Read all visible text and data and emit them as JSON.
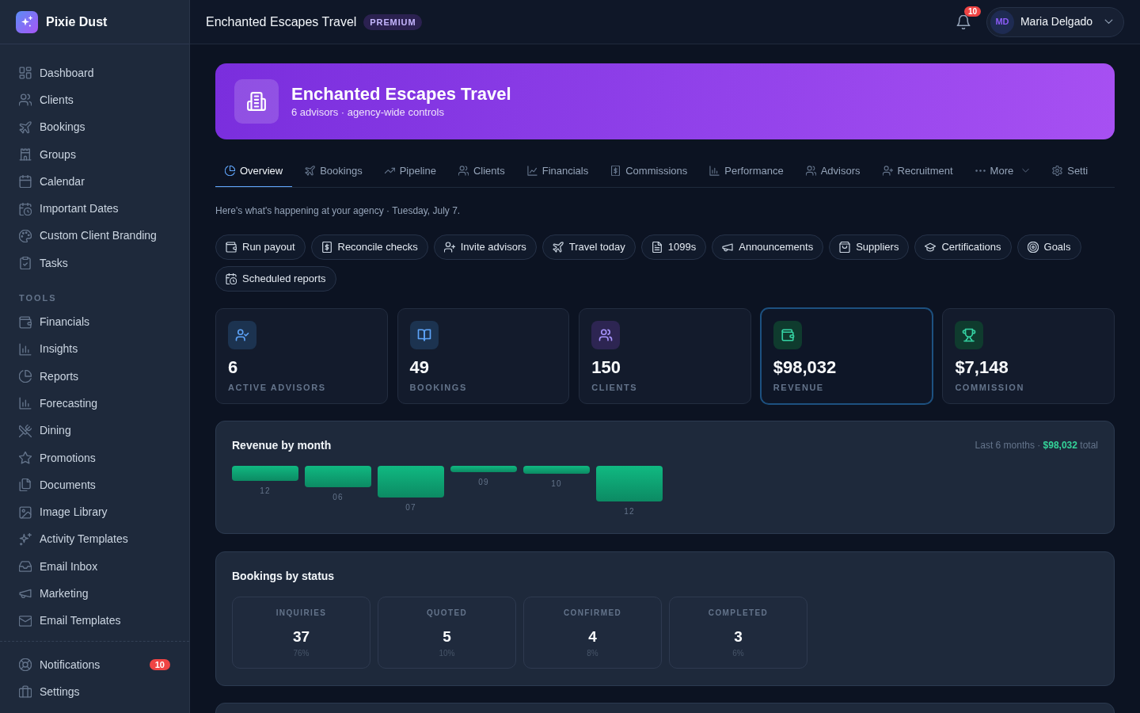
{
  "sidebar": {
    "brand": "Pixie Dust",
    "sections": [
      {
        "items": [
          {
            "label": "Dashboard"
          },
          {
            "label": "Clients"
          },
          {
            "label": "Bookings"
          },
          {
            "label": "Groups"
          },
          {
            "label": "Calendar"
          },
          {
            "label": "Important Dates"
          },
          {
            "label": "Custom Client Branding"
          },
          {
            "label": "Tasks"
          }
        ]
      },
      {
        "heading": "TOOLS",
        "items": [
          {
            "label": "Financials"
          },
          {
            "label": "Insights"
          },
          {
            "label": "Reports"
          },
          {
            "label": "Forecasting"
          },
          {
            "label": "Dining"
          },
          {
            "label": "Promotions"
          },
          {
            "label": "Documents"
          },
          {
            "label": "Image Library"
          },
          {
            "label": "Activity Templates"
          },
          {
            "label": "Email Inbox"
          },
          {
            "label": "Marketing"
          },
          {
            "label": "Email Templates"
          }
        ]
      }
    ],
    "footer_items": [
      {
        "label": "Notifications",
        "badge": "10"
      },
      {
        "label": "Settings"
      }
    ]
  },
  "header": {
    "title": "Enchanted Escapes Travel",
    "plan_badge": "PREMIUM",
    "notification_count": "10",
    "user": {
      "initials": "MD",
      "name": "Maria Delgado"
    }
  },
  "banner": {
    "title": "Enchanted Escapes Travel",
    "subtitle": "6 advisors · agency-wide controls"
  },
  "tabs": [
    {
      "label": "Overview",
      "kind": "link",
      "selected": true
    },
    {
      "label": "Bookings",
      "kind": "link",
      "selected": false
    },
    {
      "label": "Pipeline",
      "kind": "link",
      "selected": false
    },
    {
      "label": "Clients",
      "kind": "link",
      "selected": false
    },
    {
      "label": "Financials",
      "kind": "link",
      "selected": false
    },
    {
      "label": "Commissions",
      "kind": "link",
      "selected": false
    },
    {
      "label": "Performance",
      "kind": "link",
      "selected": false
    },
    {
      "label": "Advisors",
      "kind": "link",
      "selected": false
    },
    {
      "label": "Recruitment",
      "kind": "link",
      "selected": false
    },
    {
      "label": "More",
      "kind": "dropdown",
      "selected": false
    },
    {
      "label": "Setti",
      "kind": "link",
      "selected": false
    }
  ],
  "greeting": "Here's what's happening at your agency · Tuesday, July 7.",
  "quick_actions": [
    "Run payout",
    "Reconcile checks",
    "Invite advisors",
    "Travel today",
    "1099s",
    "Announcements",
    "Suppliers",
    "Certifications",
    "Goals",
    "Scheduled reports"
  ],
  "stats": [
    {
      "value": "6",
      "label": "ACTIVE ADVISORS",
      "color": "#1c3350",
      "selected": false
    },
    {
      "value": "49",
      "label": "BOOKINGS",
      "color": "#1c3350",
      "selected": false
    },
    {
      "value": "150",
      "label": "CLIENTS",
      "color": "#2d2552",
      "selected": false
    },
    {
      "value": "$98,032",
      "label": "REVENUE",
      "color": "#0f3b2e",
      "selected": true
    },
    {
      "value": "$7,148",
      "label": "COMMISSION",
      "color": "#0f3b2e",
      "selected": false
    }
  ],
  "revenue_chart": {
    "title": "Revenue by month",
    "summary": "Last 6 months · **$98,032** total",
    "month_labels": [
      "12",
      "06",
      "07",
      "09",
      "10",
      "12"
    ]
  },
  "bookings_by_status": {
    "title": "Bookings by status",
    "statuses": [
      {
        "label": "INQUIRIES",
        "count": "37",
        "share": "76%"
      },
      {
        "label": "QUOTED",
        "count": "5",
        "share": "10%"
      },
      {
        "label": "CONFIRMED",
        "count": "4",
        "share": "8%"
      },
      {
        "label": "COMPLETED",
        "count": "3",
        "share": "6%"
      }
    ]
  }
}
